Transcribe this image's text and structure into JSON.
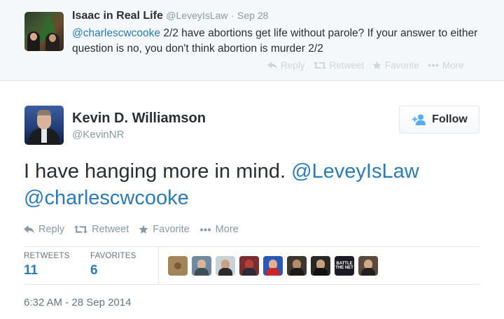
{
  "parent_tweet": {
    "name": "Isaac in Real Life",
    "handle": "@LeveyIsLaw",
    "separator": "·",
    "date": "Sep 28",
    "mention": "@charlescwcooke",
    "text": " 2/2 have abortions get life without parole?  If your answer to either question is no, you don't think abortion is murder 2/2",
    "actions": {
      "reply": "Reply",
      "retweet": "Retweet",
      "favorite": "Favorite",
      "more": "More"
    }
  },
  "main_tweet": {
    "name": "Kevin D. Williamson",
    "handle": "@KevinNR",
    "follow_label": "Follow",
    "body_text": "I have hanging more in mind. ",
    "mention_1": "@LeveyIsLaw",
    "mention_2": "@charlescwcooke",
    "actions": {
      "reply": "Reply",
      "retweet": "Retweet",
      "favorite": "Favorite",
      "more": "More"
    },
    "stats": {
      "retweets_label": "RETWEETS",
      "retweets_count": "11",
      "favorites_label": "FAVORITES",
      "favorites_count": "6"
    },
    "favoriter_avatars": [
      {
        "badge": ""
      },
      {
        "badge": ""
      },
      {
        "badge": ""
      },
      {
        "badge": ""
      },
      {
        "badge": ""
      },
      {
        "badge": ""
      },
      {
        "badge": ""
      },
      {
        "badge": "BATTLE THE NET"
      },
      {
        "badge": ""
      }
    ],
    "timestamp": "6:32 AM - 28 Sep 2014"
  },
  "colors": {
    "link": "#2b7bb9",
    "muted": "#8899a6",
    "text": "#292f33",
    "parent_bg": "#f5f8fa",
    "border": "#e1e8ed"
  },
  "icons": [
    "reply-icon",
    "retweet-icon",
    "star-icon",
    "more-dots-icon",
    "follow-person-icon"
  ]
}
